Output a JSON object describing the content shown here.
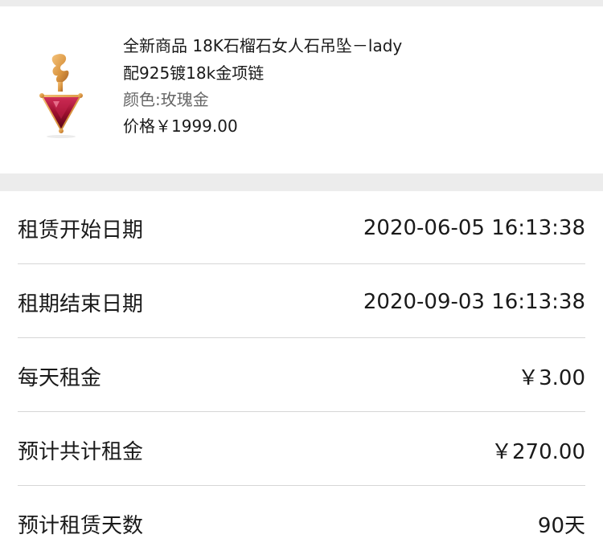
{
  "product": {
    "title_line1": "全新商品 18K石榴石女人石吊坠－lady",
    "title_line2": "配925镀18k金项链",
    "color": "颜色:玫瑰金",
    "price": "价格￥1999.00"
  },
  "details": [
    {
      "label": "租赁开始日期",
      "value": "2020-06-05 16:13:38"
    },
    {
      "label": "租期结束日期",
      "value": "2020-09-03 16:13:38"
    },
    {
      "label": "每天租金",
      "value": "￥3.00"
    },
    {
      "label": "预计共计租金",
      "value": "￥270.00"
    },
    {
      "label": "预计租赁天数",
      "value": "90天"
    }
  ],
  "colors": {
    "background": "#ececec",
    "card": "#ffffff",
    "text": "#1a1a1a",
    "muted": "#666666",
    "divider": "#d6d6d6",
    "gem": "#9b0f2e",
    "gold": "#d9a05b"
  }
}
